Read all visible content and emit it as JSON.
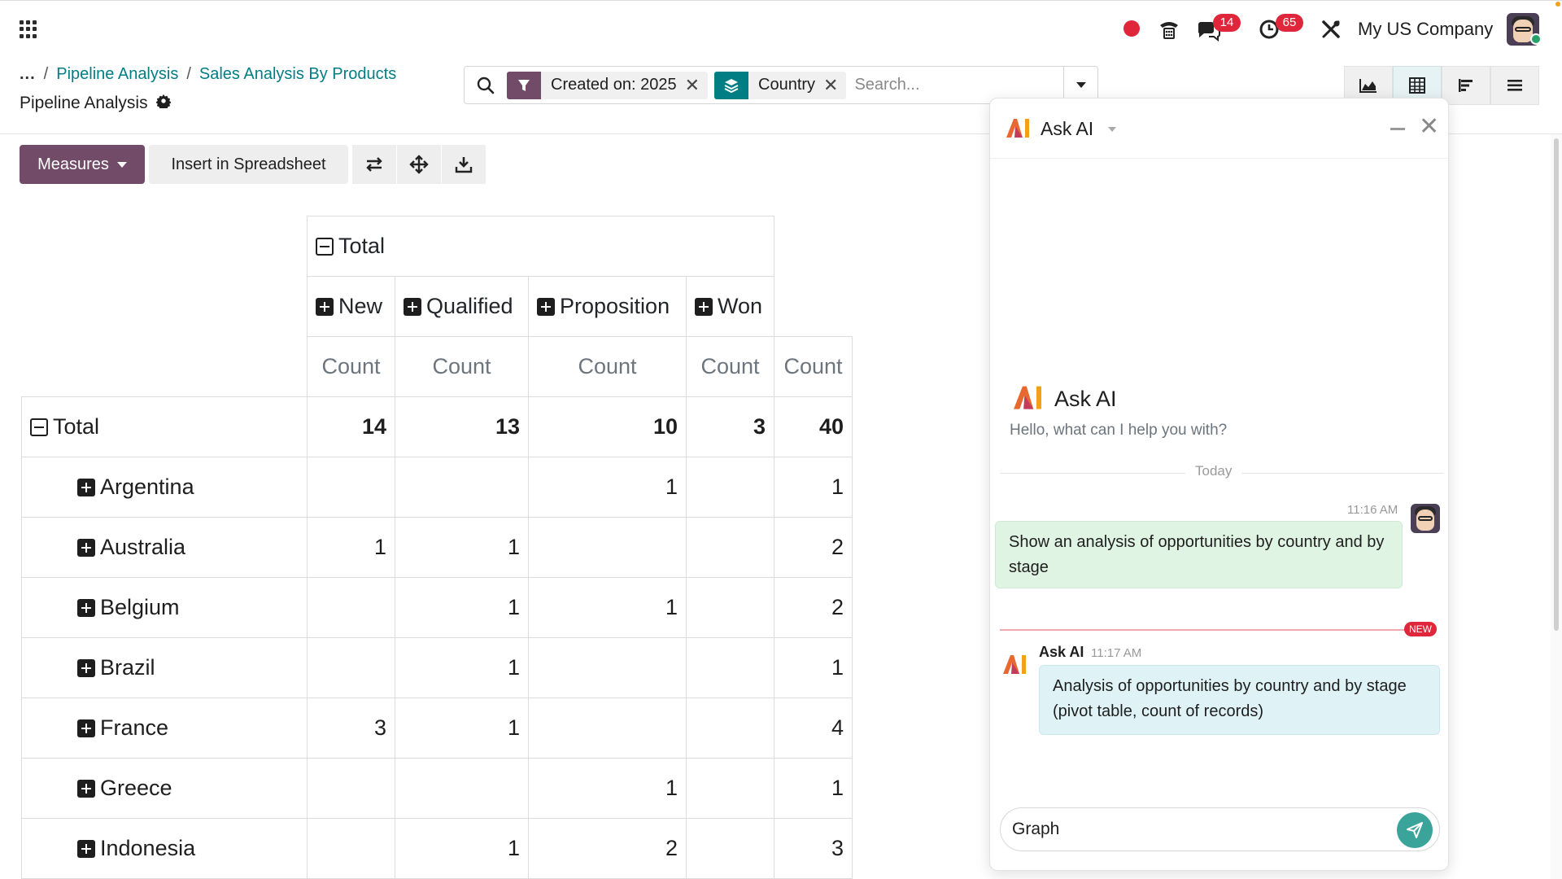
{
  "topbar": {
    "company": "My US Company",
    "chat_badge": "14",
    "activity_badge": "65"
  },
  "breadcrumb": {
    "ellipsis": "...",
    "items": [
      "Pipeline Analysis",
      "Sales Analysis By Products"
    ],
    "current": "Pipeline Analysis"
  },
  "search": {
    "facets": [
      {
        "label": "Created on: 2025",
        "kind": "filter"
      },
      {
        "label": "Country",
        "kind": "group"
      }
    ],
    "placeholder": "Search..."
  },
  "toolbar": {
    "measures_label": "Measures",
    "insert_label": "Insert in Spreadsheet"
  },
  "pivot": {
    "col_total_label": "Total",
    "stages": [
      "New",
      "Qualified",
      "Proposition",
      "Won"
    ],
    "measure_label": "Count",
    "row_total_label": "Total",
    "totals": [
      "14",
      "13",
      "10",
      "3",
      "40"
    ],
    "rows": [
      {
        "label": "Argentina",
        "values": [
          "",
          "",
          "1",
          "",
          "1"
        ]
      },
      {
        "label": "Australia",
        "values": [
          "1",
          "1",
          "",
          "",
          "2"
        ]
      },
      {
        "label": "Belgium",
        "values": [
          "",
          "1",
          "1",
          "",
          "2"
        ]
      },
      {
        "label": "Brazil",
        "values": [
          "",
          "1",
          "",
          "",
          "1"
        ]
      },
      {
        "label": "France",
        "values": [
          "3",
          "1",
          "",
          "",
          "4"
        ]
      },
      {
        "label": "Greece",
        "values": [
          "",
          "",
          "1",
          "",
          "1"
        ]
      },
      {
        "label": "Indonesia",
        "values": [
          "",
          "1",
          "2",
          "",
          "3"
        ]
      }
    ]
  },
  "ask_ai": {
    "title": "Ask AI",
    "intro_title": "Ask AI",
    "intro_sub": "Hello, what can I help you with?",
    "today": "Today",
    "user_time": "11:16 AM",
    "user_message": "Show an analysis of opportunities by country and by stage",
    "new_label": "NEW",
    "ai_name": "Ask AI",
    "ai_time": "11:17 AM",
    "ai_message": "Analysis of opportunities by country and by stage (pivot table, count of records)",
    "composer_value": "Graph"
  },
  "colors": {
    "primary": "#714b67",
    "teal": "#017e84",
    "danger": "#e0263a",
    "send": "#3aa39a"
  }
}
